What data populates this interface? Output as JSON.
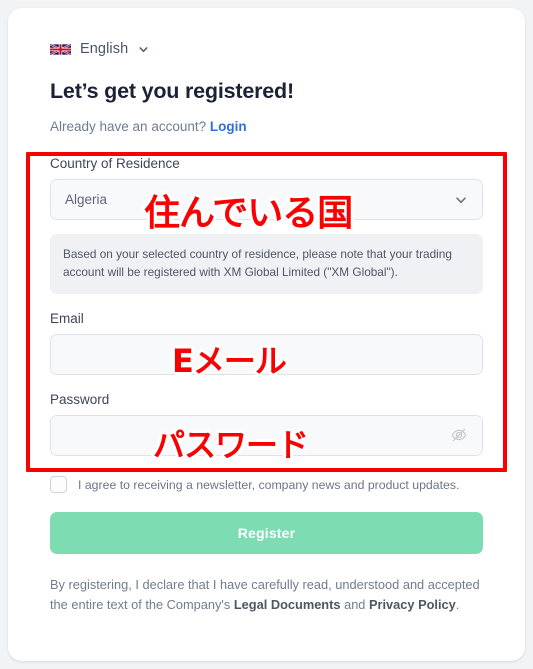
{
  "language_selector": {
    "flag_icon": "uk-flag-icon",
    "label": "English",
    "chevron_icon": "chevron-down-icon"
  },
  "heading": {
    "title": "Let’s get you registered!",
    "subtitle_prefix": "Already have an account? ",
    "login_label": "Login"
  },
  "form": {
    "country": {
      "label": "Country of Residence",
      "value": "Algeria",
      "chevron_icon": "chevron-down-icon"
    },
    "notice": "Based on your selected country of residence, please note that your trading account will be registered with XM Global Limited (\"XM Global\").",
    "email": {
      "label": "Email",
      "value": "",
      "placeholder": ""
    },
    "password": {
      "label": "Password",
      "value": "",
      "placeholder": "",
      "toggle_icon": "eye-off-icon"
    },
    "newsletter": {
      "label": "I agree to receiving a newsletter, company news and product updates.",
      "checked": false
    },
    "submit_label": "Register"
  },
  "legal": {
    "part1": "By registering, I declare that I have carefully read, understood and accepted the entire text of the Company's ",
    "link1": "Legal Documents",
    "part2": " and ",
    "link2": "Privacy Policy",
    "part3": "."
  },
  "annotations": {
    "country": "住んでいる国",
    "email": "Eメール",
    "password": "パスワード",
    "highlight_color": "#fb0000"
  },
  "colors": {
    "page_background": "#f2f3f5",
    "card_background": "#ffffff",
    "accent_link": "#2f6ee0",
    "button": "#7ddcb2",
    "heading": "#1b2236",
    "annotation": "#fb0000"
  }
}
